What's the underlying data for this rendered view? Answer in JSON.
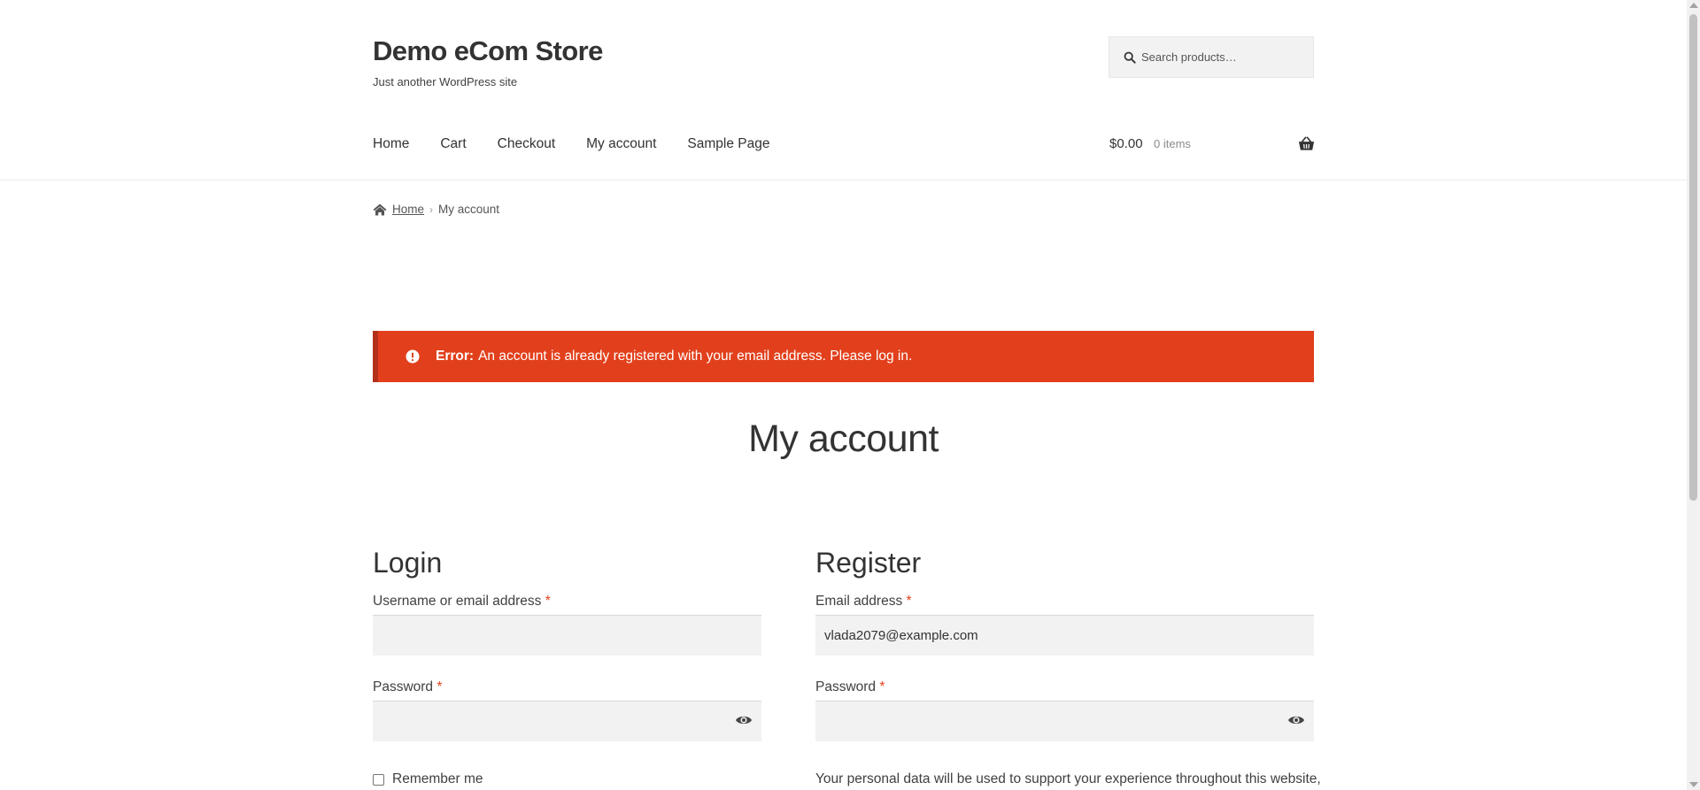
{
  "site": {
    "title": "Demo eCom Store",
    "tagline": "Just another WordPress site"
  },
  "search": {
    "placeholder": "Search products…"
  },
  "nav": {
    "items": [
      "Home",
      "Cart",
      "Checkout",
      "My account",
      "Sample Page"
    ]
  },
  "cart": {
    "amount": "$0.00",
    "count": "0 items"
  },
  "breadcrumb": {
    "home": "Home",
    "separator": "›",
    "current": "My account"
  },
  "error": {
    "label": "Error:",
    "message": "An account is already registered with your email address. Please log in.",
    "color": "#e2401c"
  },
  "page": {
    "title": "My account"
  },
  "login": {
    "heading": "Login",
    "username_label": "Username or email address",
    "username_value": "",
    "password_label": "Password",
    "password_value": "",
    "remember_label": "Remember me",
    "remember_checked": false
  },
  "register": {
    "heading": "Register",
    "email_label": "Email address",
    "email_value": "vlada2079@example.com",
    "password_label": "Password",
    "password_value": "",
    "privacy_text": "Your personal data will be used to support your experience throughout this website,"
  },
  "required_marker": "*",
  "icons": {
    "search": "search-icon",
    "basket": "basket-icon",
    "home": "home-icon",
    "error": "error-icon",
    "eye": "eye-icon"
  }
}
